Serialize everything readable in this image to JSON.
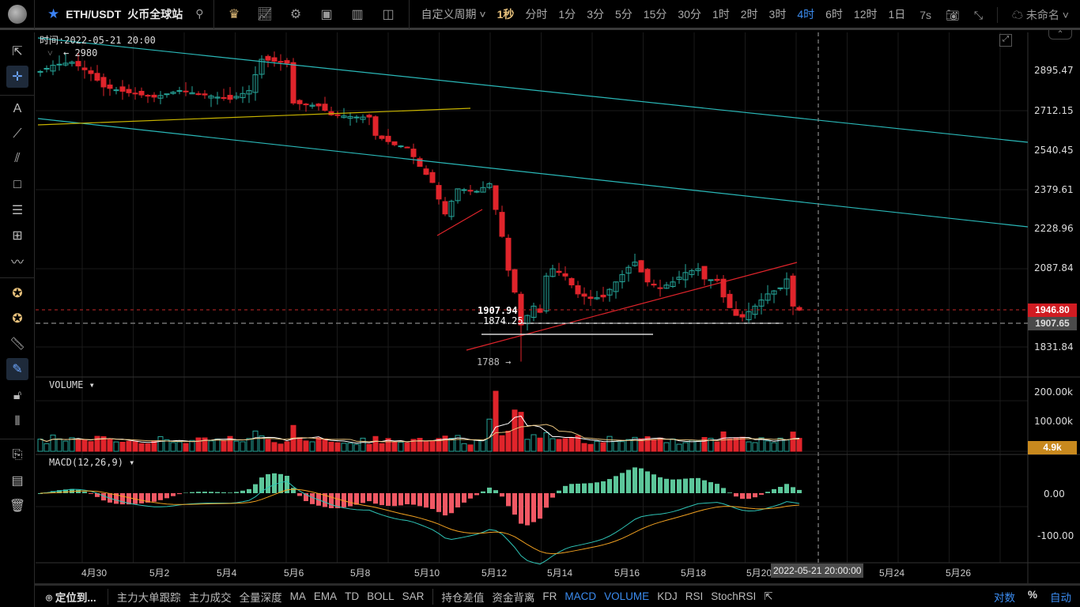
{
  "topbar": {
    "symbol": "ETH/USDT",
    "exchange": "火币全球站",
    "custom_period": "自定义周期",
    "periods": [
      "1秒",
      "分时",
      "1分",
      "3分",
      "5分",
      "15分",
      "30分",
      "1时",
      "2时",
      "3时",
      "4时",
      "6时",
      "12时",
      "1日"
    ],
    "selected_period": "1秒",
    "active_period": "4时",
    "refresh": "7s",
    "layout_name": "未命名"
  },
  "chart": {
    "time_label": "时间:2022-05-21 20:00",
    "high_marker": "← 2980",
    "low_marker": "1788 →",
    "label_1907": "1907.94",
    "label_1874": "1874.25",
    "price_axis": [
      "2895.47",
      "2712.15",
      "2540.45",
      "2379.61",
      "2228.96",
      "2087.84",
      "1831.84"
    ],
    "last_price": "1946.80",
    "cursor_price": "1907.65",
    "volume_title": "VOLUME",
    "volume_axis": [
      "200.00k",
      "100.00k"
    ],
    "volume_last": "4.9k",
    "macd_title": "MACD(12,26,9)",
    "macd_axis": [
      "0.00",
      "-100.00"
    ],
    "time_axis": [
      "4月30",
      "5月2",
      "5月4",
      "5月6",
      "5月8",
      "5月10",
      "5月12",
      "5月14",
      "5月16",
      "5月18",
      "5月20",
      "5月24",
      "5月26"
    ],
    "cursor_time": "2022-05-21 20:00:00",
    "colors": {
      "up": "#26a69a",
      "down": "#e0242b",
      "line_cyan": "#2ab8b8",
      "line_yellow": "#c8b400"
    }
  },
  "chart_data": {
    "type": "candlestick",
    "interval": "4h",
    "anchors": [
      [
        0,
        2890
      ],
      [
        2,
        2920
      ],
      [
        5,
        2935
      ],
      [
        8,
        2880
      ],
      [
        10,
        2817
      ],
      [
        14,
        2790
      ],
      [
        18,
        2770
      ],
      [
        22,
        2800
      ],
      [
        26,
        2780
      ],
      [
        30,
        2760
      ],
      [
        33,
        2800
      ],
      [
        35,
        2949
      ],
      [
        39,
        2930
      ],
      [
        40,
        2743
      ],
      [
        44,
        2730
      ],
      [
        46,
        2690
      ],
      [
        50,
        2680
      ],
      [
        52,
        2680
      ],
      [
        53,
        2600
      ],
      [
        56,
        2560
      ],
      [
        58,
        2550
      ],
      [
        60,
        2470
      ],
      [
        62,
        2405
      ],
      [
        63,
        2340
      ],
      [
        64,
        2283
      ],
      [
        66,
        2380
      ],
      [
        69,
        2370
      ],
      [
        71,
        2400
      ],
      [
        72,
        2300
      ],
      [
        73,
        2200
      ],
      [
        74,
        2080
      ],
      [
        75,
        2006
      ],
      [
        76,
        1900
      ],
      [
        77,
        1930
      ],
      [
        78,
        1960
      ],
      [
        79,
        1940
      ],
      [
        80,
        2060
      ],
      [
        81,
        2085
      ],
      [
        83,
        2060
      ],
      [
        85,
        2000
      ],
      [
        87,
        1985
      ],
      [
        89,
        1990
      ],
      [
        91,
        2040
      ],
      [
        93,
        2090
      ],
      [
        94,
        2108
      ],
      [
        96,
        2040
      ],
      [
        98,
        2019
      ],
      [
        100,
        2040
      ],
      [
        102,
        2072
      ],
      [
        104,
        2085
      ],
      [
        105,
        2050
      ],
      [
        107,
        2045
      ],
      [
        108,
        1990
      ],
      [
        109,
        1955
      ],
      [
        110,
        1930
      ],
      [
        111,
        1925
      ],
      [
        113,
        1960
      ],
      [
        115,
        2000
      ],
      [
        117,
        2020
      ],
      [
        118,
        2050
      ],
      [
        119,
        1960
      ],
      [
        120,
        1947
      ]
    ],
    "low": 1788,
    "high": 2980,
    "ylim": [
      1760,
      3000
    ]
  }
}
